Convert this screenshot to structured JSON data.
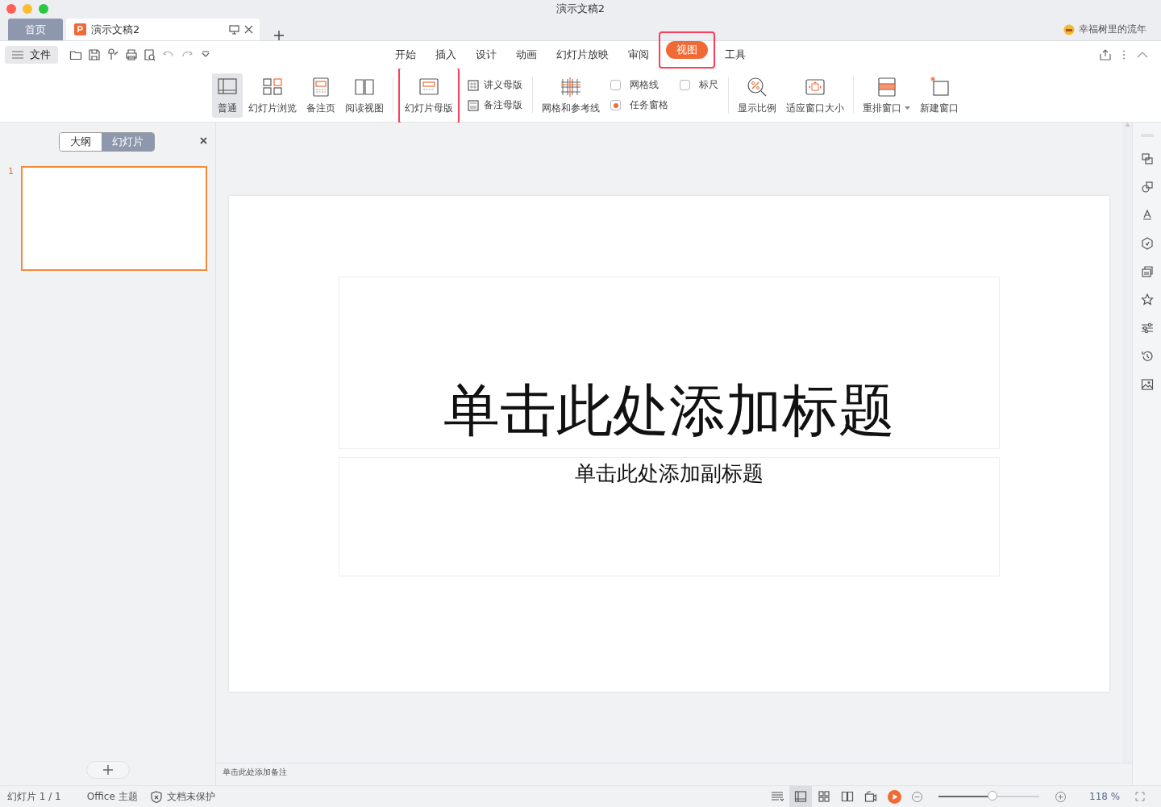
{
  "window": {
    "title": "演示文稿2"
  },
  "doc_tabs": [
    {
      "label": "首页",
      "kind": "home",
      "selected": false
    },
    {
      "label": "演示文稿2",
      "kind": "doc",
      "selected": true
    }
  ],
  "user": {
    "name": "幸福树里的流年"
  },
  "file_menu": {
    "label": "文件"
  },
  "menu_tabs": [
    {
      "label": "开始",
      "selected": false
    },
    {
      "label": "插入",
      "selected": false
    },
    {
      "label": "设计",
      "selected": false
    },
    {
      "label": "动画",
      "selected": false
    },
    {
      "label": "幻灯片放映",
      "selected": false
    },
    {
      "label": "审阅",
      "selected": false
    },
    {
      "label": "视图",
      "selected": true,
      "highlighted": true
    },
    {
      "label": "工具",
      "selected": false
    }
  ],
  "ribbon": {
    "groups": [
      {
        "items": [
          {
            "kind": "large",
            "label": "普通",
            "selected": true
          },
          {
            "kind": "large",
            "label": "幻灯片浏览",
            "selected": false
          },
          {
            "kind": "large",
            "label": "备注页",
            "selected": false
          },
          {
            "kind": "large",
            "label": "阅读视图",
            "selected": false
          }
        ]
      },
      {
        "items": [
          {
            "kind": "large",
            "label": "幻灯片母版",
            "highlighted": true
          },
          {
            "kind": "small",
            "label": "讲义母版"
          },
          {
            "kind": "small",
            "label": "备注母版"
          }
        ]
      },
      {
        "items": [
          {
            "kind": "large",
            "label": "网格和参考线"
          },
          {
            "kind": "check",
            "label": "网格线",
            "checked": false
          },
          {
            "kind": "check",
            "label": "任务窗格",
            "checked": true
          },
          {
            "kind": "check",
            "label": "标尺",
            "checked": false
          }
        ]
      },
      {
        "items": [
          {
            "kind": "large",
            "label": "显示比例"
          },
          {
            "kind": "large",
            "label": "适应窗口大小"
          }
        ]
      },
      {
        "items": [
          {
            "kind": "large",
            "label": "重排窗口",
            "dropdown": true
          },
          {
            "kind": "large",
            "label": "新建窗口"
          }
        ]
      }
    ]
  },
  "pane": {
    "tabs": [
      {
        "label": "大纲",
        "selected": false
      },
      {
        "label": "幻灯片",
        "selected": true
      }
    ],
    "slides": [
      {
        "number": "1",
        "selected": true
      }
    ]
  },
  "slide": {
    "title": "单击此处添加标题",
    "subtitle": "单击此处添加副标题"
  },
  "notes": {
    "placeholder": "单击此处添加备注"
  },
  "status_bar": {
    "slide_count": "幻灯片 1 / 1",
    "theme": "Office 主题",
    "protection": "文档未保护",
    "zoom": {
      "level": 0.54,
      "reading": "118 %"
    }
  }
}
